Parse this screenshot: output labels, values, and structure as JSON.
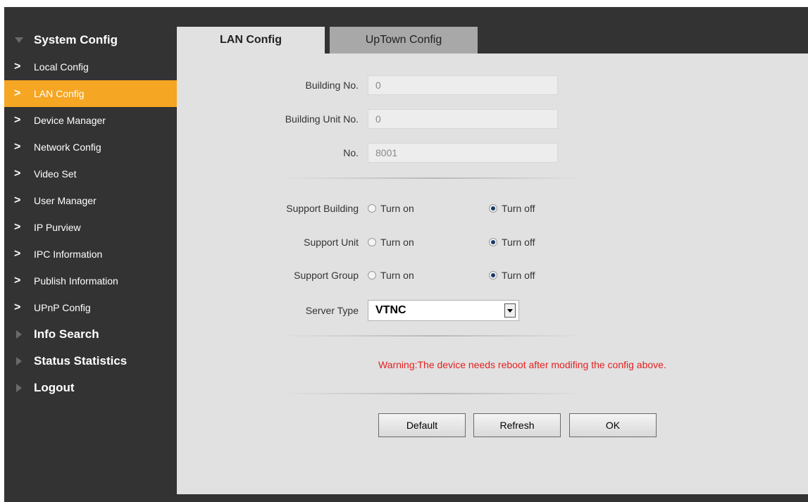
{
  "sidebar": {
    "system_config": "System Config",
    "items": [
      {
        "label": "Local Config"
      },
      {
        "label": "LAN Config"
      },
      {
        "label": "Device Manager"
      },
      {
        "label": "Network Config"
      },
      {
        "label": "Video Set"
      },
      {
        "label": "User Manager"
      },
      {
        "label": "IP Purview"
      },
      {
        "label": "IPC Information"
      },
      {
        "label": "Publish Information"
      },
      {
        "label": "UPnP Config"
      }
    ],
    "info_search": "Info Search",
    "status_statistics": "Status Statistics",
    "logout": "Logout",
    "chevron": ">"
  },
  "tabs": {
    "lan": "LAN Config",
    "uptown": "UpTown Config"
  },
  "form": {
    "building_no_label": "Building No.",
    "building_no_value": "0",
    "building_unit_label": "Building Unit No.",
    "building_unit_value": "0",
    "no_label": "No.",
    "no_value": "8001",
    "support_building_label": "Support Building",
    "support_unit_label": "Support Unit",
    "support_group_label": "Support Group",
    "turn_on": "Turn on",
    "turn_off": "Turn off",
    "server_type_label": "Server Type",
    "server_type_value": "VTNC"
  },
  "warning": "Warning:The device needs reboot after modifing the config above.",
  "buttons": {
    "default": "Default",
    "refresh": "Refresh",
    "ok": "OK"
  },
  "colors": {
    "accent": "#f5a623",
    "warning": "#e52020",
    "sidebar_bg": "#333333",
    "content_bg": "#e1e1e1"
  }
}
